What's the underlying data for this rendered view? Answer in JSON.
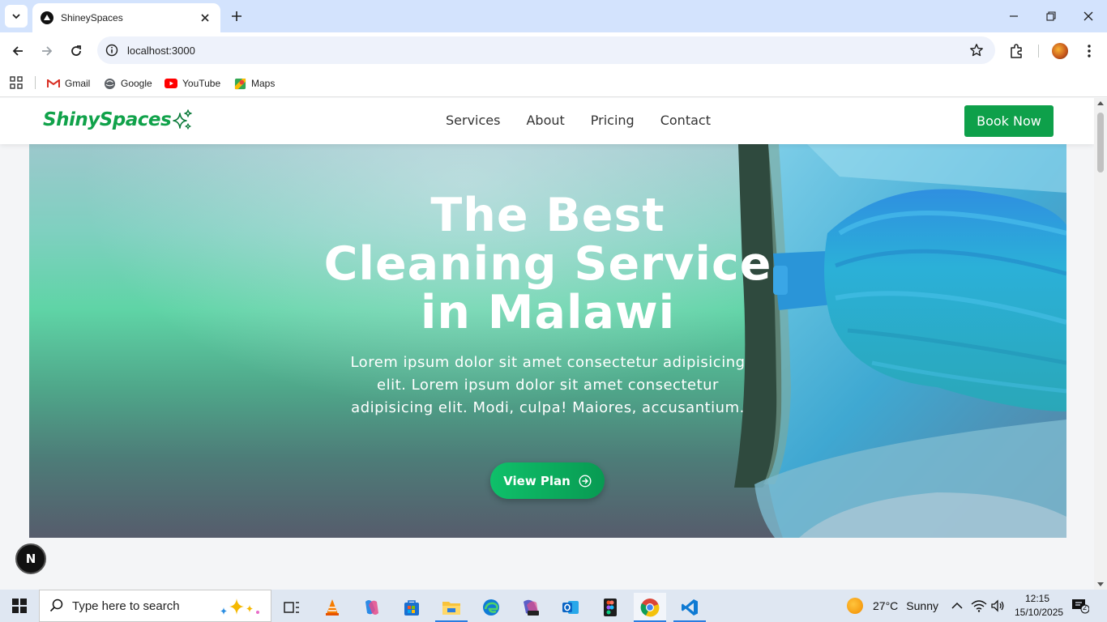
{
  "browser": {
    "tab_title": "ShineySpaces",
    "url": "localhost:3000",
    "bookmarks": [
      {
        "label": "Gmail",
        "icon": "gmail-icon"
      },
      {
        "label": "Google",
        "icon": "google-icon"
      },
      {
        "label": "YouTube",
        "icon": "youtube-icon"
      },
      {
        "label": "Maps",
        "icon": "maps-icon"
      }
    ]
  },
  "site": {
    "logo": "ShinySpaces",
    "nav": [
      "Services",
      "About",
      "Pricing",
      "Contact"
    ],
    "book_label": "Book Now",
    "hero": {
      "title_lines": [
        "The Best",
        "Cleaning Service",
        "in Malawi"
      ],
      "subtitle": "Lorem ipsum dolor sit amet consectetur adipisicing elit. Lorem ipsum dolor sit amet consectetur adipisicing elit. Modi, culpa! Maiores, accusantium.",
      "cta": "View Plan"
    },
    "badge": "N",
    "colors": {
      "brand_green": "#10a24a",
      "button_green": "#0ea04a"
    }
  },
  "taskbar": {
    "search_placeholder": "Type here to search",
    "weather_temp": "27°C",
    "weather_text": "Sunny",
    "time": "12:15",
    "date": "15/10/2025",
    "notification_count": "2"
  }
}
